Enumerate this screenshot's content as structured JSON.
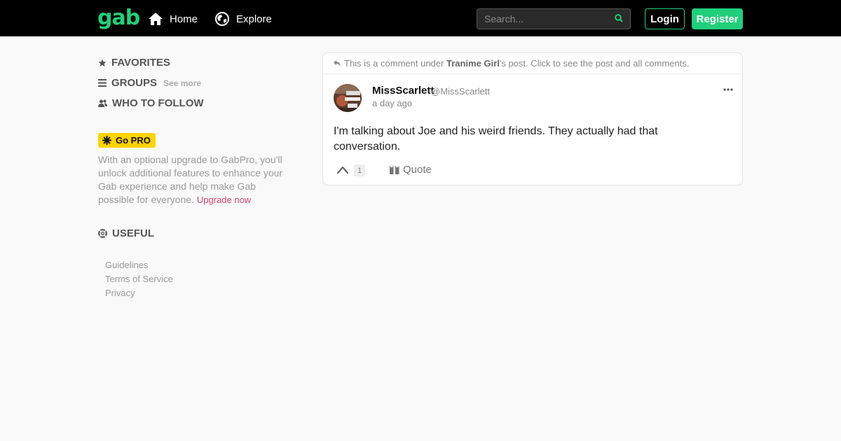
{
  "header": {
    "logo": "gab",
    "nav": [
      {
        "label": "Home",
        "icon": "home-icon"
      },
      {
        "label": "Explore",
        "icon": "globe-icon"
      }
    ],
    "search_placeholder": "Search...",
    "login_label": "Login",
    "register_label": "Register",
    "accent_color": "#21cf7a"
  },
  "sidebar": {
    "favorites": "FAVORITES",
    "groups": "GROUPS",
    "groups_see_more": "See more",
    "who_to_follow": "WHO TO FOLLOW",
    "gopro_badge": "Go PRO",
    "gopro_text": "With an optional upgrade to GabPro, you'll unlock additional features to enhance your Gab experience and help make Gab possible for everyone.",
    "gopro_link": "Upgrade now",
    "useful": "USEFUL",
    "links": [
      "Guidelines",
      "Terms of Service",
      "Privacy"
    ]
  },
  "post": {
    "context_prefix": "This is a comment under ",
    "context_user": "Tranime Girl",
    "context_suffix": "'s post. Click to see the post and all comments.",
    "author_name": "MissScarlett",
    "author_handle": "@MissScarlett",
    "time": "a day ago",
    "body": "I'm talking about Joe and his weird friends. They actually had that conversation.",
    "vote_count": "1",
    "quote_label": "Quote"
  }
}
